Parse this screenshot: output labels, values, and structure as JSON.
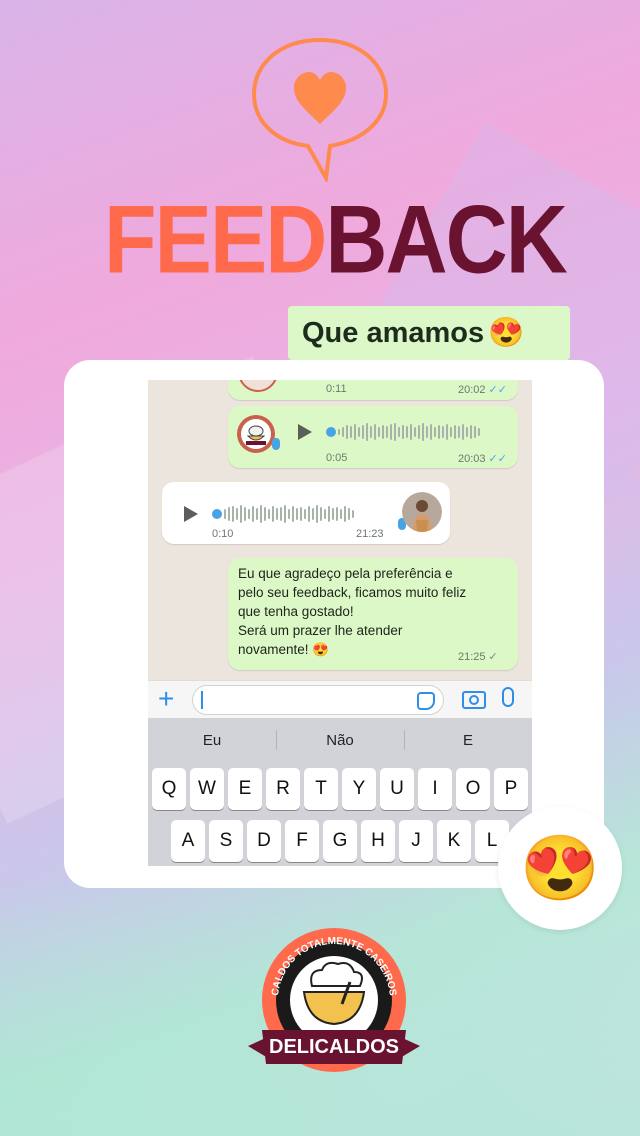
{
  "header": {
    "title_part1": "FEED",
    "title_part2": "BACK",
    "tagline": "Que amamos",
    "tagline_emoji": "😍"
  },
  "chat": {
    "messages": [
      {
        "type": "audio",
        "direction": "out",
        "duration": "0:11",
        "time": "20:02",
        "status": "✓✓"
      },
      {
        "type": "audio",
        "direction": "out",
        "duration": "0:05",
        "time": "20:03",
        "status": "✓✓"
      },
      {
        "type": "audio",
        "direction": "in",
        "duration": "0:10",
        "time": "21:23"
      },
      {
        "type": "text",
        "direction": "out",
        "lines": [
          "Eu que agradeço pela preferência e",
          "pelo seu feedback, ficamos muito feliz",
          "que tenha gostado!",
          "Será um prazer lhe atender",
          "novamente! 😍"
        ],
        "time": "21:25",
        "status": "✓"
      }
    ]
  },
  "input_bar": {
    "plus_icon": "+",
    "placeholder": "",
    "icons": [
      "plus-icon",
      "sticker-icon",
      "camera-icon",
      "microphone-icon"
    ]
  },
  "keyboard": {
    "suggestions": [
      "Eu",
      "Não",
      "E"
    ],
    "row1": [
      "Q",
      "W",
      "E",
      "R",
      "T",
      "Y",
      "U",
      "I",
      "O",
      "P"
    ],
    "row2": [
      "A",
      "S",
      "D",
      "F",
      "G",
      "H",
      "J",
      "K",
      "L"
    ]
  },
  "overlay_emoji": "😍",
  "logo": {
    "arc_text": "CALDOS TOTALMENTE CASEIROS",
    "name": "DELICALDOS"
  },
  "colors": {
    "feed": "#ff6a4d",
    "back": "#6a1330",
    "tagline_bg": "#dcf7c8",
    "bubble_out": "#dcf8c6",
    "accent_blue": "#2f8ee8"
  }
}
